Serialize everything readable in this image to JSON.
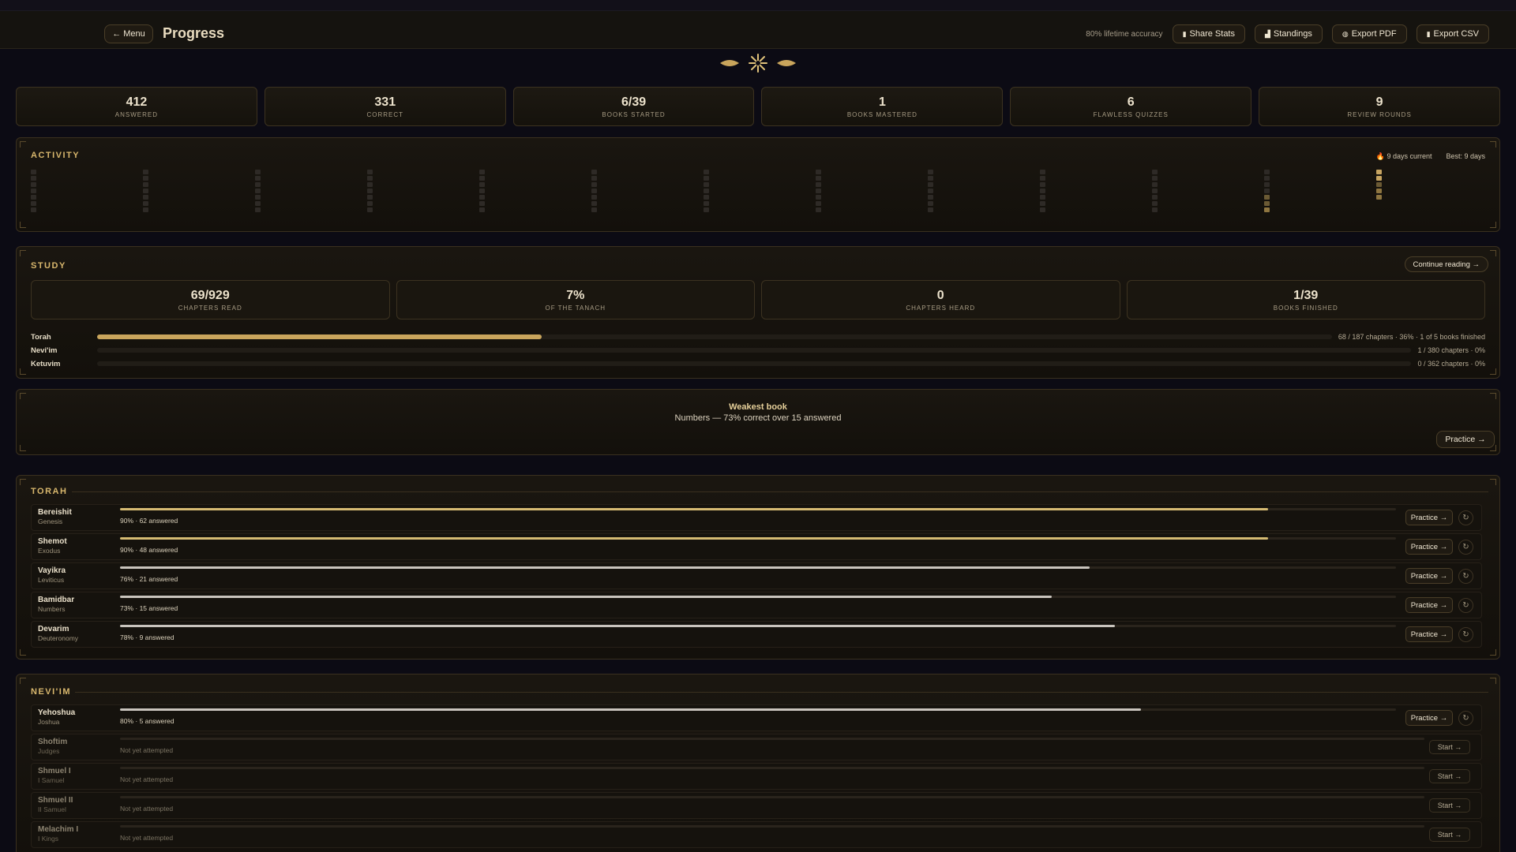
{
  "header": {
    "menu_label": "← Menu",
    "title": "Progress",
    "accuracy_text": "80% lifetime accuracy",
    "buttons": [
      "Share Stats",
      "Standings",
      "Export PDF",
      "Export CSV"
    ]
  },
  "stats": [
    {
      "value": "412",
      "label": "ANSWERED"
    },
    {
      "value": "331",
      "label": "CORRECT"
    },
    {
      "value": "6/39",
      "label": "BOOKS STARTED"
    },
    {
      "value": "1",
      "label": "BOOKS MASTERED"
    },
    {
      "value": "6",
      "label": "FLAWLESS QUIZZES"
    },
    {
      "value": "9",
      "label": "REVIEW ROUNDS"
    }
  ],
  "activity": {
    "title": "ACTIVITY",
    "current_streak": "9 days current",
    "best_streak": "Best: 9 days",
    "weeks": [
      [
        0,
        0,
        0,
        0,
        0,
        0,
        0
      ],
      [
        0,
        0,
        0,
        0,
        0,
        0,
        0
      ],
      [
        0,
        0,
        0,
        0,
        0,
        0,
        0
      ],
      [
        0,
        0,
        0,
        0,
        0,
        0,
        0
      ],
      [
        0,
        0,
        0,
        0,
        0,
        0,
        0
      ],
      [
        0,
        0,
        0,
        0,
        0,
        0,
        0
      ],
      [
        0,
        0,
        0,
        0,
        0,
        0,
        0
      ],
      [
        0,
        0,
        0,
        0,
        0,
        0,
        0
      ],
      [
        0,
        0,
        0,
        0,
        0,
        0,
        0
      ],
      [
        0,
        0,
        0,
        0,
        0,
        0,
        0
      ],
      [
        0,
        0,
        0,
        0,
        0,
        0,
        0
      ],
      [
        0,
        0,
        0,
        0,
        1,
        1,
        2
      ],
      [
        3,
        3,
        1,
        2,
        2
      ]
    ]
  },
  "study": {
    "title": "STUDY",
    "continue_label": "Continue reading →",
    "cards": [
      {
        "value": "69/929",
        "label": "CHAPTERS READ"
      },
      {
        "value": "7%",
        "label": "OF THE TANACH"
      },
      {
        "value": "0",
        "label": "CHAPTERS HEARD"
      },
      {
        "value": "1/39",
        "label": "BOOKS FINISHED"
      }
    ],
    "bars": [
      {
        "label": "Torah",
        "fraction": 0.36,
        "text": "68 / 187 chapters · 36% · 1 of 5 books finished"
      },
      {
        "label": "Nevi'im",
        "fraction": 0.0,
        "text": "1 / 380 chapters · 0%"
      },
      {
        "label": "Ketuvim",
        "fraction": 0.0,
        "text": "0 / 362 chapters · 0%"
      }
    ]
  },
  "weakest": {
    "title": "Weakest book",
    "text": "Numbers — 73% correct over 15 answered",
    "practice_label": "Practice →"
  },
  "sections": [
    {
      "title": "TORAH",
      "books": [
        {
          "name": "Bereishit",
          "english": "Genesis",
          "fraction": 0.9,
          "meta": "90% · 62 answered",
          "action": "Practice →",
          "attempted": true,
          "mastered": true
        },
        {
          "name": "Shemot",
          "english": "Exodus",
          "fraction": 0.9,
          "meta": "90% · 48 answered",
          "action": "Practice →",
          "attempted": true,
          "mastered": true
        },
        {
          "name": "Vayikra",
          "english": "Leviticus",
          "fraction": 0.76,
          "meta": "76% · 21 answered",
          "action": "Practice →",
          "attempted": true,
          "mastered": false
        },
        {
          "name": "Bamidbar",
          "english": "Numbers",
          "fraction": 0.73,
          "meta": "73% · 15 answered",
          "action": "Practice →",
          "attempted": true,
          "mastered": false
        },
        {
          "name": "Devarim",
          "english": "Deuteronomy",
          "fraction": 0.78,
          "meta": "78% · 9 answered",
          "action": "Practice →",
          "attempted": true,
          "mastered": false
        }
      ]
    },
    {
      "title": "NEVI'IM",
      "books": [
        {
          "name": "Yehoshua",
          "english": "Joshua",
          "fraction": 0.8,
          "meta": "80% · 5 answered",
          "action": "Practice →",
          "attempted": true,
          "mastered": false
        },
        {
          "name": "Shoftim",
          "english": "Judges",
          "fraction": 0,
          "meta": "Not yet attempted",
          "action": "Start →",
          "attempted": false,
          "mastered": false
        },
        {
          "name": "Shmuel I",
          "english": "I Samuel",
          "fraction": 0,
          "meta": "Not yet attempted",
          "action": "Start →",
          "attempted": false,
          "mastered": false
        },
        {
          "name": "Shmuel II",
          "english": "II Samuel",
          "fraction": 0,
          "meta": "Not yet attempted",
          "action": "Start →",
          "attempted": false,
          "mastered": false
        },
        {
          "name": "Melachim I",
          "english": "I Kings",
          "fraction": 0,
          "meta": "Not yet attempted",
          "action": "Start →",
          "attempted": false,
          "mastered": false
        }
      ]
    }
  ],
  "colors": {
    "accent_gold": "#c9a55c",
    "mastered_bar": "#d6bb73",
    "progress_bar": "#c9c4bd",
    "activity_high": "#c6a461"
  }
}
